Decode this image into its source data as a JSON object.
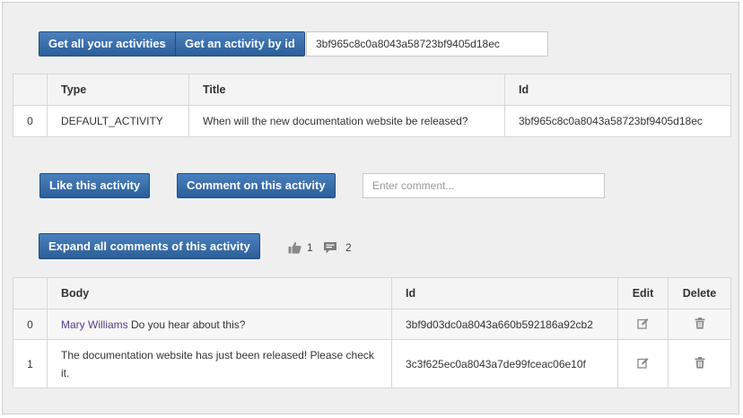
{
  "toolbar": {
    "get_all_label": "Get all your activities",
    "get_by_id_label": "Get an activity by id",
    "activity_id_value": "3bf965c8c0a8043a58723bf9405d18ec"
  },
  "activities_table": {
    "columns": [
      "",
      "Type",
      "Title",
      "Id"
    ],
    "rows": [
      {
        "index": "0",
        "type": "DEFAULT_ACTIVITY",
        "title": "When will the new documentation website be released?",
        "id": "3bf965c8c0a8043a58723bf9405d18ec"
      }
    ]
  },
  "actions": {
    "like_label": "Like this activity",
    "comment_label": "Comment on this activity",
    "comment_placeholder": "Enter comment...",
    "expand_label": "Expand all comments of this activity"
  },
  "reactions": {
    "like_icon": "thumbs-up-icon",
    "likes_count": "1",
    "comment_icon": "speech-bubble-icon",
    "comments_count": "2"
  },
  "comments_table": {
    "columns": [
      "",
      "Body",
      "Id",
      "Edit",
      "Delete"
    ],
    "rows": [
      {
        "index": "0",
        "author": "Mary Williams",
        "body": " Do you hear about this?",
        "id": "3bf9d03dc0a8043a660b592186a92cb2",
        "edit_icon": "edit-icon",
        "delete_icon": "trash-icon"
      },
      {
        "index": "1",
        "author": "",
        "body": "The documentation website has just been released! Please check it.",
        "id": "3c3f625ec0a8043a7de99fceac06e10f",
        "edit_icon": "edit-icon",
        "delete_icon": "trash-icon"
      }
    ]
  },
  "colors": {
    "button_blue": "#2f66a3",
    "author_link": "#5a3d8a",
    "panel_bg": "#efefef"
  }
}
